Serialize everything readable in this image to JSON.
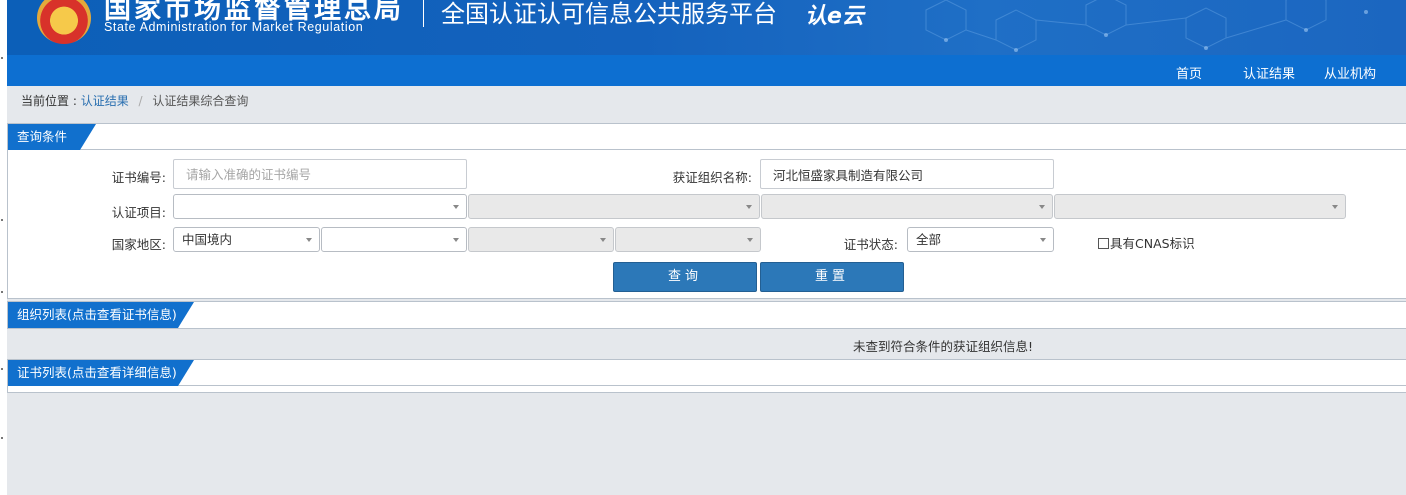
{
  "header": {
    "agency_name": "国家市场监督管理总局",
    "agency_name_en": "State Administration  for  Market Regulation",
    "platform_title": "全国认证认可信息公共服务平台",
    "logo_text": "认e云"
  },
  "nav": {
    "items": [
      "首页",
      "认证结果",
      "从业机构"
    ]
  },
  "breadcrumb": {
    "prefix": "当前位置 :",
    "link": "认证结果",
    "separator": "/",
    "current": "认证结果综合查询"
  },
  "query_panel": {
    "title": "查询条件",
    "cert_no_label": "证书编号:",
    "cert_no_placeholder": "请输入准确的证书编号",
    "cert_no_value": "",
    "org_name_label": "获证组织名称:",
    "org_name_value": "河北恒盛家具制造有限公司",
    "project_label": "认证项目:",
    "project_value": "",
    "region_label": "国家地区:",
    "region_value": "中国境内",
    "region_sub_value": "",
    "status_label": "证书状态:",
    "status_value": "全部",
    "cnas_label": "具有CNAS标识",
    "cnas_checked": false,
    "search_button": "查询",
    "reset_button": "重置"
  },
  "org_panel": {
    "title": "组织列表(点击查看证书信息)",
    "empty_message": "未查到符合条件的获证组织信息!"
  },
  "cert_panel": {
    "title": "证书列表(点击查看详细信息)"
  },
  "colors": {
    "banner": "#1462bd",
    "navbar": "#0d6fd1",
    "tab": "#1170cd",
    "button": "#2c78b8",
    "page_bg": "#e5e8ec"
  }
}
